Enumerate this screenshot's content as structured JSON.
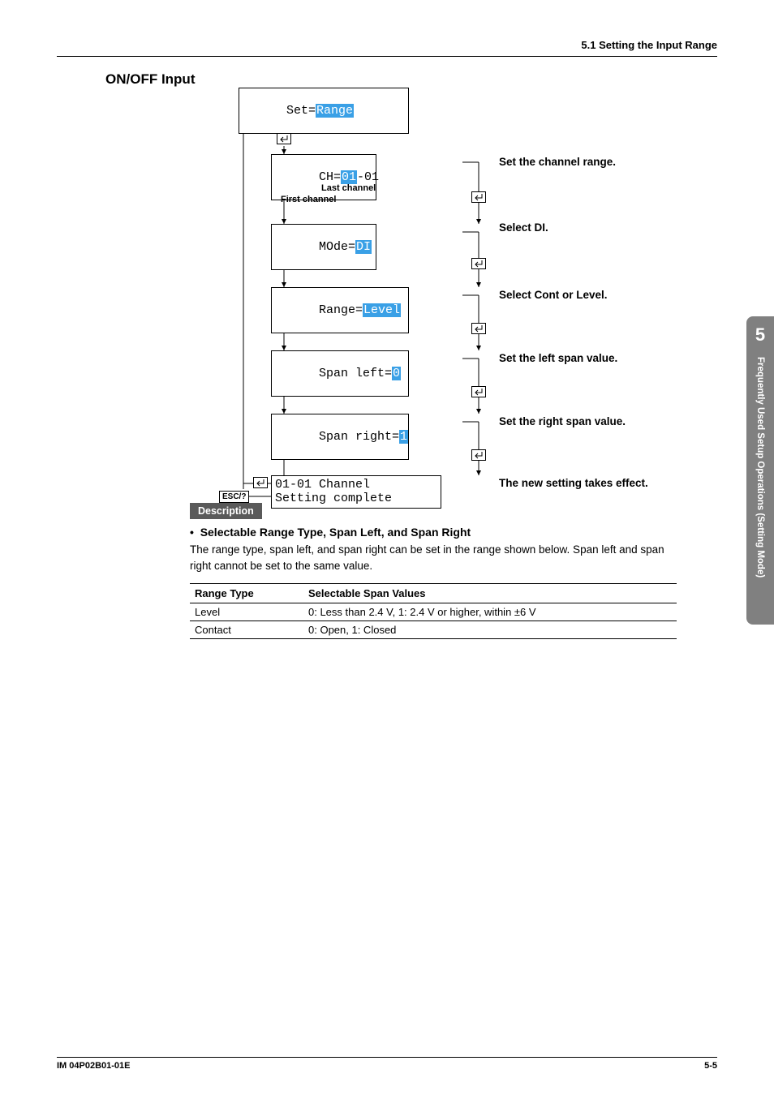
{
  "header": {
    "breadcrumb": "5.1  Setting the Input Range"
  },
  "section": {
    "title": "ON/OFF Input"
  },
  "sidebar": {
    "chapter": "5",
    "label": "Frequently Used Setup Operations (Setting Mode)"
  },
  "diagram": {
    "set_prefix": "Set=",
    "set_value": "Range",
    "ch_prefix": "CH=",
    "ch_hl": "01",
    "ch_suffix": "-01",
    "ch_caption": "Set the channel range.",
    "first_channel": "First channel",
    "last_channel": "Last channel",
    "mode_prefix": "MOde=",
    "mode_value": "DI",
    "mode_caption": "Select DI.",
    "range_prefix": "Range=",
    "range_value": "Level",
    "range_caption": "Select Cont or Level.",
    "spanl_prefix": "Span left=",
    "spanl_value": "0",
    "spanl_caption": "Set the left span value.",
    "spanr_prefix": "Span right=",
    "spanr_value": "1",
    "spanr_caption": "Set the right span value.",
    "result_line1": "01-01 Channel",
    "result_line2": "Setting complete",
    "result_caption": "The new setting takes effect.",
    "esc_label": "ESC/?"
  },
  "description": {
    "chip": "Description",
    "bullet_title": "Selectable Range Type, Span Left, and Span Right",
    "body": "The range type, span left, and span right can be set in the range shown below. Span left and span right cannot be set to the same value.",
    "table": {
      "headers": [
        "Range Type",
        "Selectable Span Values"
      ],
      "rows": [
        [
          "Level",
          "0: Less than 2.4 V, 1: 2.4 V or higher, within ±6 V"
        ],
        [
          "Contact",
          "0: Open, 1: Closed"
        ]
      ]
    }
  },
  "footer": {
    "left": "IM 04P02B01-01E",
    "right": "5-5"
  }
}
